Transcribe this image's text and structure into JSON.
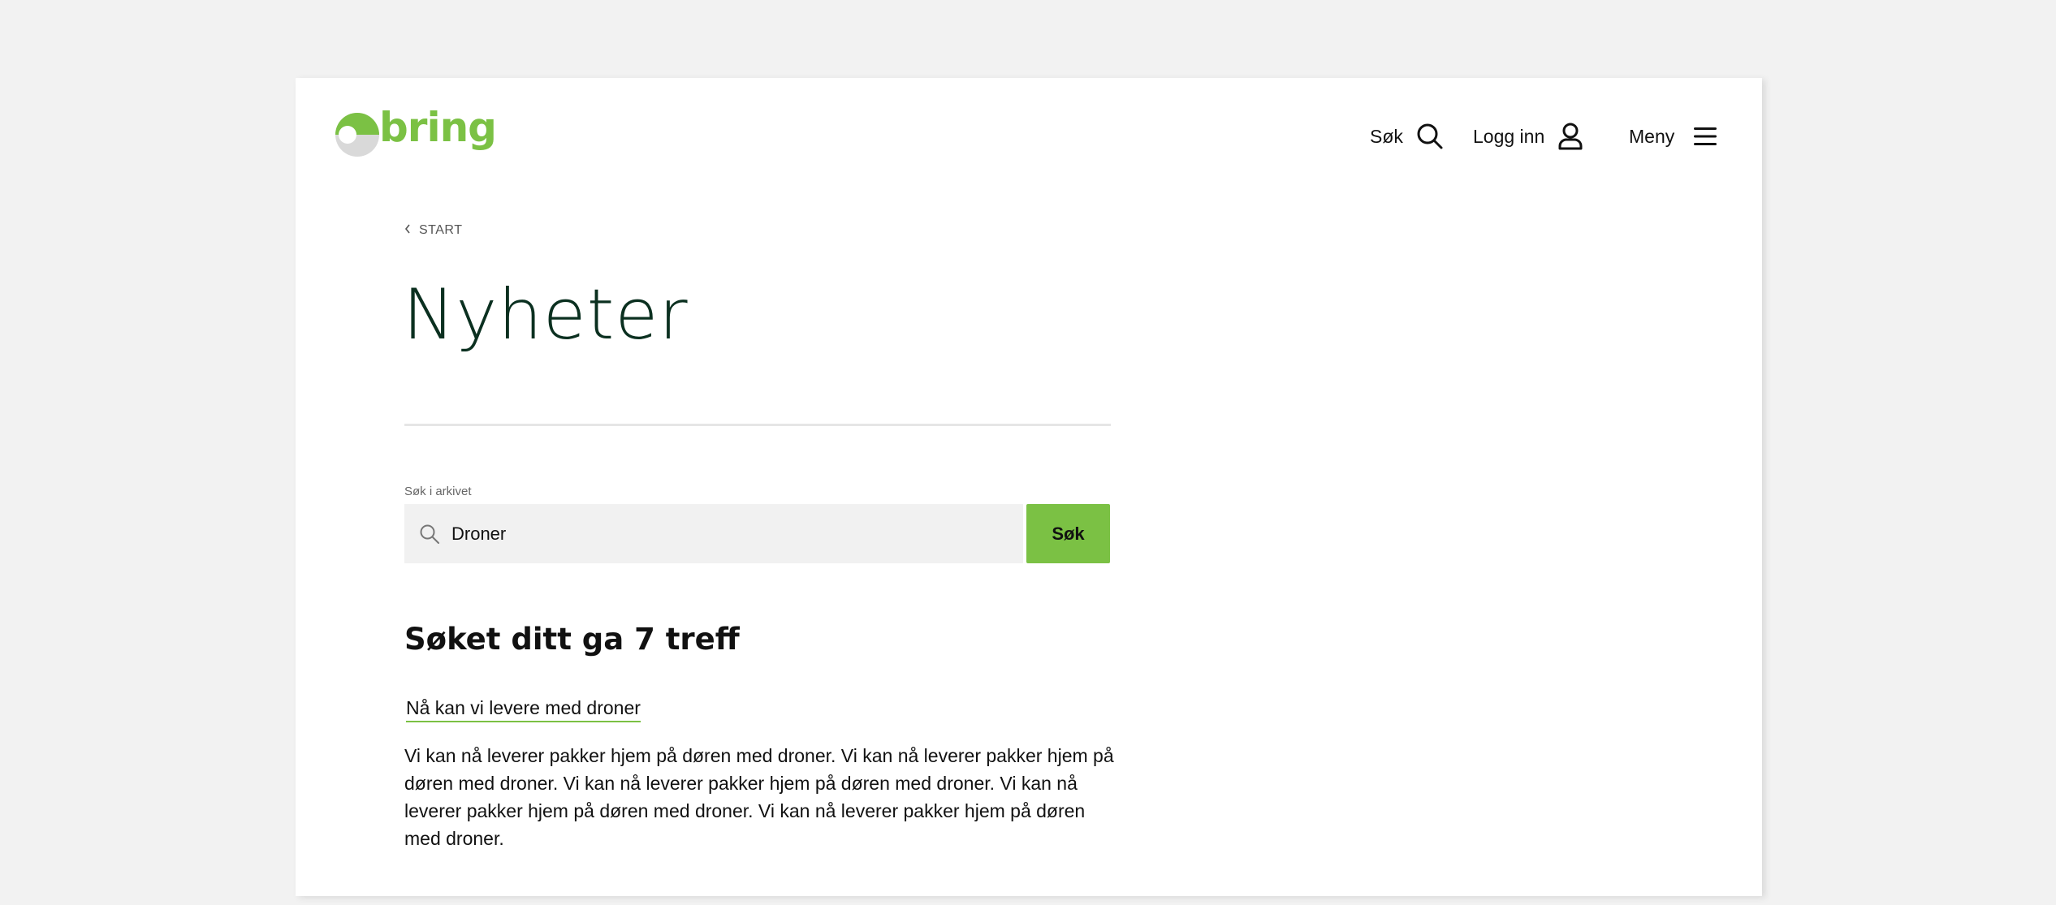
{
  "header": {
    "logo_text": "bring",
    "nav": {
      "search_label": "Søk",
      "login_label": "Logg inn",
      "menu_label": "Meny"
    }
  },
  "breadcrumb": {
    "label": "START"
  },
  "page_title": "Nyheter",
  "archive_search": {
    "label": "Søk i arkivet",
    "value": "Droner",
    "button_label": "Søk"
  },
  "results": {
    "count_text": "Søket ditt ga 7 treff",
    "items": [
      {
        "title": "Nå kan vi levere med droner",
        "excerpt": "Vi kan nå leverer pakker hjem på døren med droner. Vi kan nå leverer pakker hjem på døren med droner. Vi kan nå leverer pakker hjem på døren med droner. Vi kan nå leverer pakker hjem på døren med droner. Vi kan nå leverer pakker hjem på døren med droner."
      }
    ]
  },
  "colors": {
    "brand_green": "#7bc144",
    "title_dark_green": "#0b3020",
    "background": "#f2f2f2"
  },
  "icons": [
    "bring-logo",
    "search-icon",
    "user-icon",
    "hamburger-icon",
    "chevron-left-icon"
  ]
}
